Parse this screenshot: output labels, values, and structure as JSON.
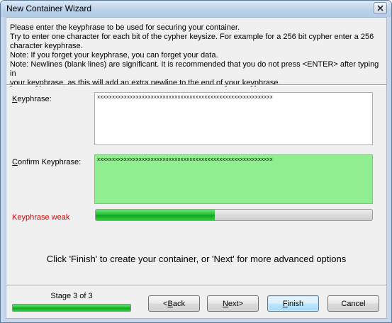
{
  "window": {
    "title": "New Container Wizard",
    "close_icon": "close-icon"
  },
  "intro": {
    "lines": [
      "Please enter the keyphrase to be used for securing your container.",
      "Try to enter one character for each bit of the cypher keysize. For example for a 256 bit cypher enter a 256",
      "character keyphrase.",
      "Note: If you forget your keyphrase, you can forget your data.",
      "Note: Newlines (blank lines) are significant. It is recommended that you do not press <ENTER> after typing in",
      "your keyphrase, as this will add an extra newline to the end of your keyphrase."
    ]
  },
  "keyphrase": {
    "label": "Keyphrase:",
    "value": "xxxxxxxxxxxxxxxxxxxxxxxxxxxxxxxxxxxxxxxxxxxxxxxxxxxxxxxxxxx"
  },
  "confirm": {
    "label": "Confirm Keyphrase:",
    "value": "xxxxxxxxxxxxxxxxxxxxxxxxxxxxxxxxxxxxxxxxxxxxxxxxxxxxxxxxxxx",
    "match_color": "#90ee90"
  },
  "strength": {
    "label": "Keyphrase weak",
    "label_color": "#d40000",
    "fraction": 0.43
  },
  "hint": "Click 'Finish' to create your container, or 'Next' for more advanced options",
  "stage": {
    "label": "Stage 3 of 3",
    "fraction": 1.0
  },
  "buttons": {
    "back": "Back",
    "next": "Next",
    "finish": "Finish",
    "cancel": "Cancel"
  }
}
